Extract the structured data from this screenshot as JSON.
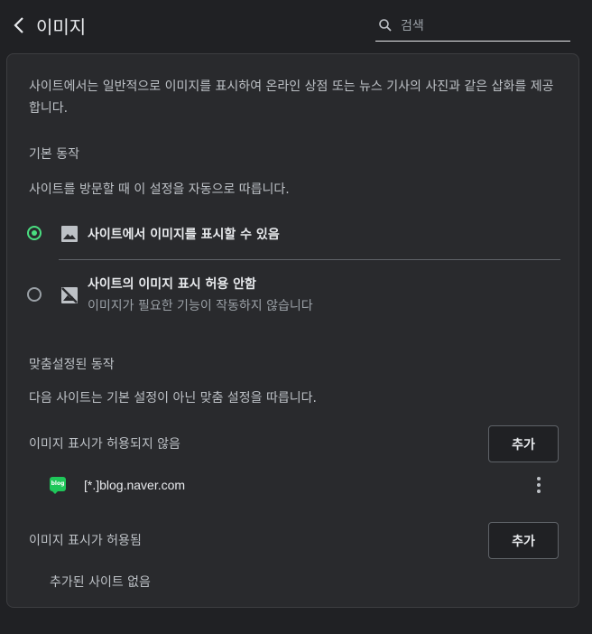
{
  "header": {
    "title": "이미지",
    "search_placeholder": "검색"
  },
  "intro": {
    "description": "사이트에서는 일반적으로 이미지를 표시하여 온라인 상점 또는 뉴스 기사의 사진과 같은 삽화를 제공합니다."
  },
  "default_behavior": {
    "heading": "기본 동작",
    "subtext": "사이트를 방문할 때 이 설정을 자동으로 따릅니다.",
    "options": [
      {
        "label": "사이트에서 이미지를 표시할 수 있음",
        "selected": true,
        "icon": "image-icon"
      },
      {
        "label": "사이트의 이미지 표시 허용 안함",
        "sub": "이미지가 필요한 기능이 작동하지 않습니다",
        "selected": false,
        "icon": "image-off-icon"
      }
    ]
  },
  "custom_behavior": {
    "heading": "맞춤설정된 동작",
    "subtext": "다음 사이트는 기본 설정이 아닌 맞춤 설정을 따릅니다.",
    "blocked": {
      "label": "이미지 표시가 허용되지 않음",
      "add_label": "추가",
      "sites": [
        {
          "favicon": "blog",
          "name": "[*.]blog.naver.com"
        }
      ]
    },
    "allowed": {
      "label": "이미지 표시가 허용됨",
      "add_label": "추가",
      "empty": "추가된 사이트 없음"
    }
  },
  "colors": {
    "background": "#202124",
    "card": "#292a2d",
    "accent": "#4ade80",
    "naver_green": "#1fc75a"
  }
}
